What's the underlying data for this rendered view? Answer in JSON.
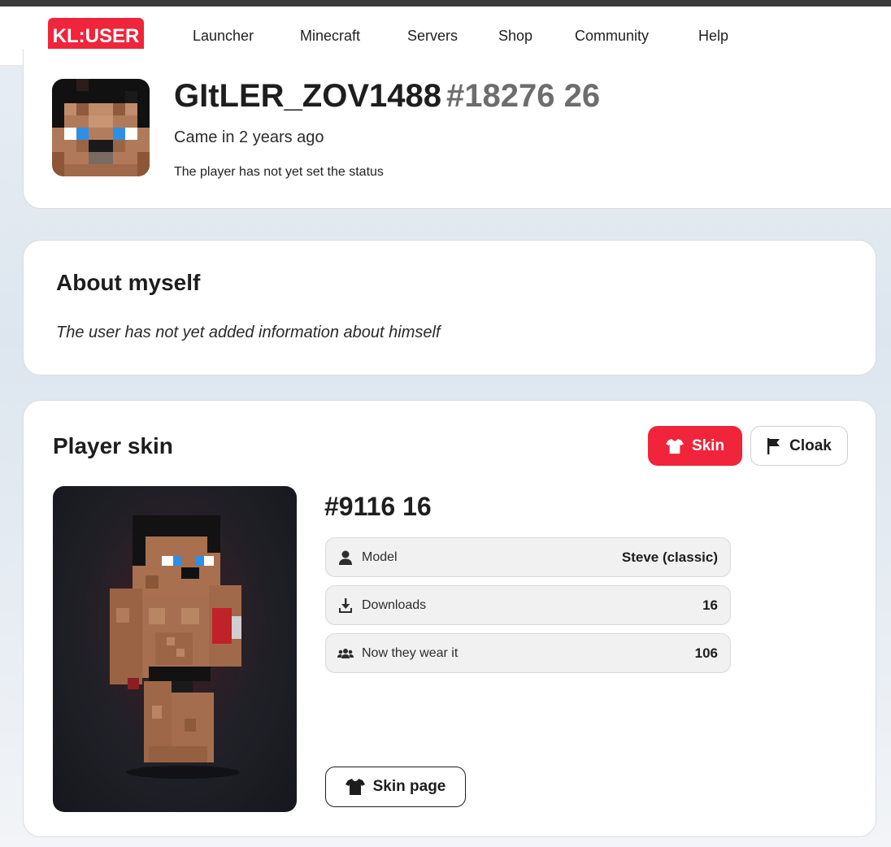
{
  "nav": {
    "logo": "KL:USER",
    "items": [
      "Launcher",
      "Minecraft",
      "Servers",
      "Shop",
      "Community",
      "Help"
    ]
  },
  "profile": {
    "username": "GItLER_ZOV1488",
    "user_id": "#18276 26",
    "last_seen": "Came in 2 years ago",
    "status": "The player has not yet set the status"
  },
  "about": {
    "title": "About myself",
    "text": "The user has not yet added information about himself"
  },
  "skin": {
    "title": "Player skin",
    "tabs": {
      "skin": "Skin",
      "cloak": "Cloak"
    },
    "skin_id": "#9116 16",
    "stats": [
      {
        "label": "Model",
        "value": "Steve (classic)",
        "icon": "user-icon"
      },
      {
        "label": "Downloads",
        "value": "16",
        "icon": "download-icon"
      },
      {
        "label": "Now they wear it",
        "value": "106",
        "icon": "users-icon"
      }
    ],
    "page_button": "Skin page"
  },
  "colors": {
    "accent": "#f0243a",
    "text": "#1d1d1d",
    "muted": "#6d6d6d"
  }
}
